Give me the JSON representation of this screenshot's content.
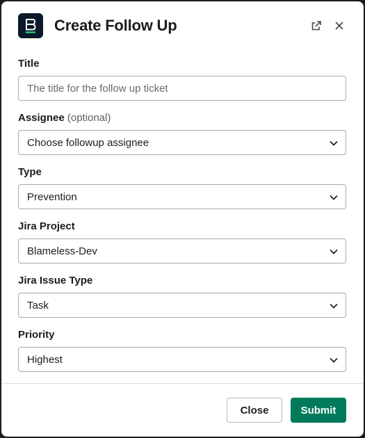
{
  "header": {
    "title": "Create Follow Up",
    "app_icon": "blameless-logo-icon",
    "external_icon": "external-link-icon",
    "close_icon": "close-icon"
  },
  "fields": {
    "title": {
      "label": "Title",
      "placeholder": "The title for the follow up ticket"
    },
    "assignee": {
      "label": "Assignee",
      "optional": "(optional)",
      "value": "Choose followup assignee"
    },
    "type": {
      "label": "Type",
      "value": "Prevention"
    },
    "jira_project": {
      "label": "Jira Project",
      "value": "Blameless-Dev"
    },
    "jira_issue_type": {
      "label": "Jira Issue Type",
      "value": "Task"
    },
    "priority": {
      "label": "Priority",
      "value": "Highest"
    }
  },
  "footer": {
    "close_label": "Close",
    "submit_label": "Submit"
  },
  "colors": {
    "submit_bg": "#007a5a",
    "app_icon_bg": "#0b1a2a",
    "app_icon_accent": "#2bd48a"
  }
}
